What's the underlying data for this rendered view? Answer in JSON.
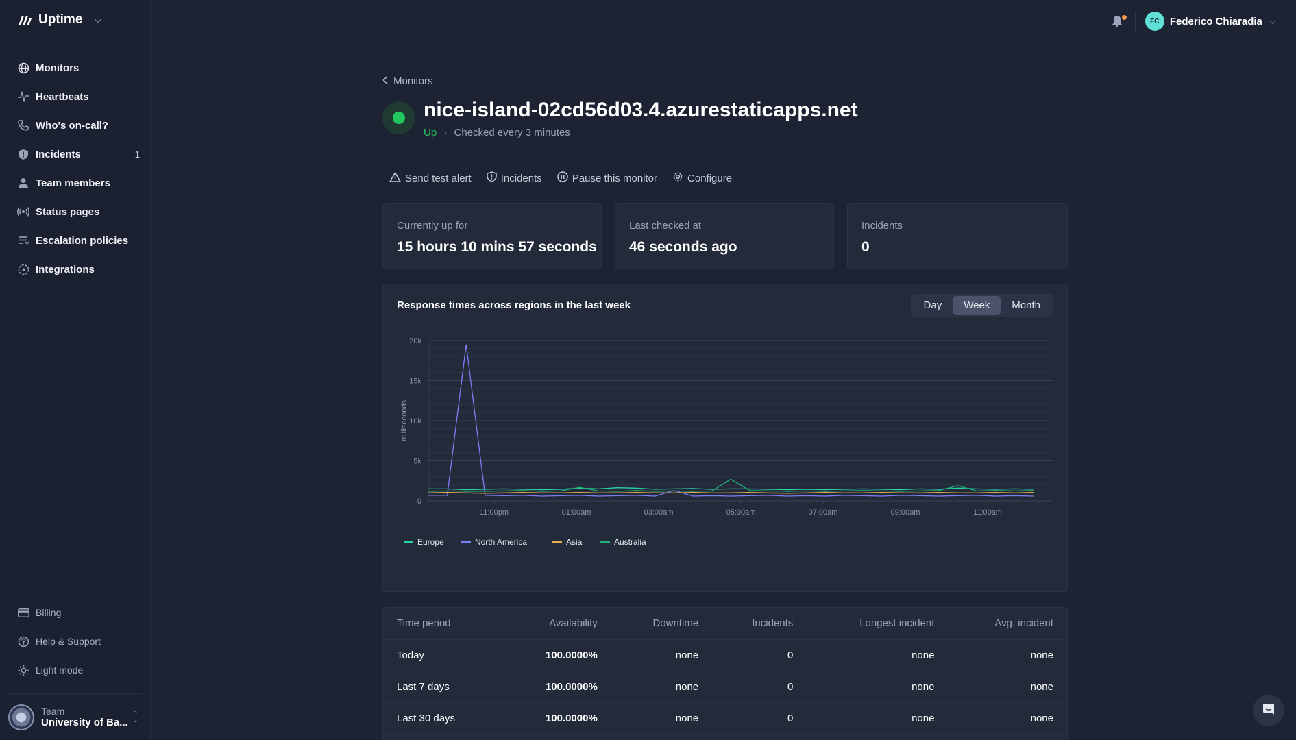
{
  "brand": {
    "name": "Uptime"
  },
  "nav": {
    "items": [
      {
        "label": "Monitors",
        "icon": "globe-icon"
      },
      {
        "label": "Heartbeats",
        "icon": "pulse-icon"
      },
      {
        "label": "Who's on-call?",
        "icon": "phone-icon"
      },
      {
        "label": "Incidents",
        "icon": "shield-icon",
        "count": "1"
      },
      {
        "label": "Team members",
        "icon": "user-icon"
      },
      {
        "label": "Status pages",
        "icon": "broadcast-icon"
      },
      {
        "label": "Escalation policies",
        "icon": "list-icon"
      },
      {
        "label": "Integrations",
        "icon": "puzzle-icon"
      }
    ],
    "bottom": [
      {
        "label": "Billing",
        "icon": "card-icon"
      },
      {
        "label": "Help & Support",
        "icon": "help-icon"
      },
      {
        "label": "Light mode",
        "icon": "sun-icon"
      }
    ]
  },
  "team": {
    "label": "Team",
    "name": "University of Ba..."
  },
  "user": {
    "initials": "FC",
    "name": "Federico Chiaradia"
  },
  "monitor": {
    "back_label": "Monitors",
    "name": "nice-island-02cd56d03.4.azurestaticapps.net",
    "status": "Up",
    "separator": "·",
    "check_text": "Checked every 3 minutes"
  },
  "actions": [
    "Send test alert",
    "Incidents",
    "Pause this monitor",
    "Configure"
  ],
  "stats": [
    {
      "label": "Currently up for",
      "value": "15 hours 10 mins 57 seconds"
    },
    {
      "label": "Last checked at",
      "value": "46 seconds ago"
    },
    {
      "label": "Incidents",
      "value": "0"
    }
  ],
  "chart_panel": {
    "title": "Response times across regions in the last week",
    "ranges": [
      "Day",
      "Week",
      "Month"
    ],
    "active_range": "Week"
  },
  "chart_data": {
    "type": "line",
    "ylabel": "milliseconds",
    "ylim": [
      0,
      20000
    ],
    "y_ticks": [
      "0",
      "5k",
      "10k",
      "15k",
      "20k"
    ],
    "x_ticks": [
      "11:00pm",
      "01:00am",
      "03:00am",
      "05:00am",
      "07:00am",
      "09:00am",
      "11:00am"
    ],
    "x": [
      "21:00",
      "21:30",
      "22:00",
      "22:30",
      "23:00",
      "23:30",
      "00:00",
      "00:30",
      "01:00",
      "01:30",
      "02:00",
      "02:30",
      "03:00",
      "03:30",
      "04:00",
      "04:30",
      "05:00",
      "05:30",
      "06:00",
      "06:30",
      "07:00",
      "07:30",
      "08:00",
      "08:30",
      "09:00",
      "09:30",
      "10:00",
      "10:30",
      "11:00",
      "11:30",
      "12:00",
      "12:30",
      "13:00"
    ],
    "series": [
      {
        "name": "Europe",
        "color": "#2dd4a7",
        "values": [
          1500,
          1500,
          1400,
          1450,
          1500,
          1450,
          1400,
          1450,
          1600,
          1500,
          1650,
          1600,
          1450,
          1500,
          1550,
          1450,
          1500,
          1500,
          1450,
          1400,
          1450,
          1400,
          1450,
          1500,
          1450,
          1400,
          1500,
          1450,
          1600,
          1500,
          1450,
          1500,
          1450
        ]
      },
      {
        "name": "North America",
        "color": "#7b7ff5",
        "values": [
          700,
          700,
          19500,
          700,
          650,
          700,
          600,
          650,
          700,
          600,
          650,
          700,
          600,
          1300,
          600,
          650,
          600,
          650,
          700,
          600,
          650,
          600,
          700,
          650,
          600,
          700,
          650,
          600,
          650,
          700,
          600,
          650,
          600
        ]
      },
      {
        "name": "Asia",
        "color": "#e8b04a",
        "values": [
          1000,
          1050,
          1000,
          950,
          1000,
          1050,
          1000,
          1000,
          1050,
          1000,
          1000,
          1050,
          1000,
          1000,
          1050,
          1000,
          1000,
          1050,
          1000,
          950,
          1000,
          1050,
          1000,
          1000,
          1050,
          1000,
          1000,
          1050,
          1000,
          1000,
          1050,
          1000,
          1050
        ]
      },
      {
        "name": "Australia",
        "color": "#22b07a",
        "values": [
          1200,
          1250,
          1200,
          1200,
          1250,
          1300,
          1200,
          1250,
          1700,
          1250,
          1200,
          1300,
          1200,
          1250,
          1200,
          1250,
          2700,
          1300,
          1250,
          1200,
          1250,
          1200,
          1250,
          1300,
          1250,
          1200,
          1250,
          1300,
          1900,
          1250,
          1300,
          1250,
          1300
        ]
      }
    ],
    "legend": "bottom-left",
    "grid": true
  },
  "table": {
    "headers": [
      "Time period",
      "Availability",
      "Downtime",
      "Incidents",
      "Longest incident",
      "Avg. incident"
    ],
    "rows": [
      [
        "Today",
        "100.0000%",
        "none",
        "0",
        "none",
        "none"
      ],
      [
        "Last 7 days",
        "100.0000%",
        "none",
        "0",
        "none",
        "none"
      ],
      [
        "Last 30 days",
        "100.0000%",
        "none",
        "0",
        "none",
        "none"
      ]
    ]
  }
}
